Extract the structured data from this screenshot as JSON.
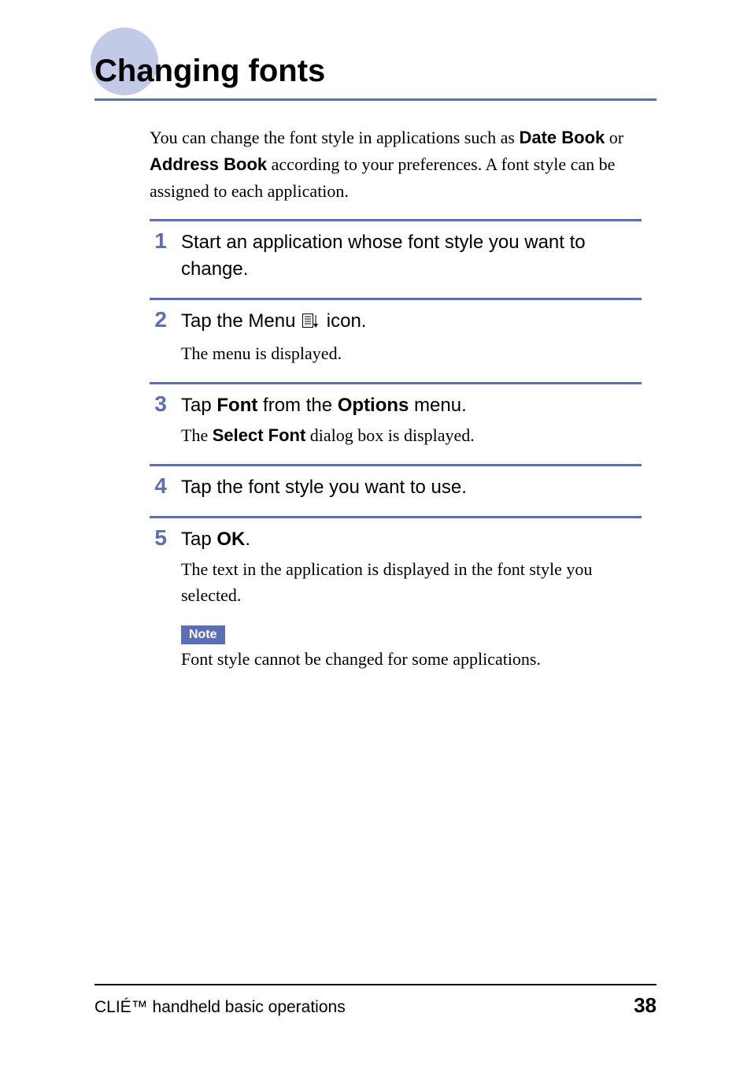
{
  "title": "Changing fonts",
  "intro_html": "You can change the font style in applications such as <b class='sans'>Date Book</b> or <b class='sans'>Address Book</b> according to your preferences. A font style can be assigned to each application.",
  "steps": [
    {
      "num": "1",
      "head_html": "Start an application whose font style you want to change.",
      "sub_html": ""
    },
    {
      "num": "2",
      "head_html": "Tap the Menu <span class='menu-icon' data-name='menu-icon' data-interactable='false'><svg width='22' height='20' viewBox='0 0 22 20'><rect x='0.5' y='0.5' width='13' height='17' fill='none' stroke='#000'/><line x1='3' y1='4' x2='11' y2='4' stroke='#000'/><line x1='3' y1='7' x2='11' y2='7' stroke='#000'/><line x1='3' y1='10' x2='11' y2='10' stroke='#000'/><line x1='3' y1='13' x2='11' y2='13' stroke='#000'/><line x1='17' y1='2' x2='17' y2='14' stroke='#000'/><polygon points='14,13 20,13 17,18' fill='#000'/></svg></span> icon.",
      "sub_html": "The menu is displayed."
    },
    {
      "num": "3",
      "head_html": "Tap <b class='sans'>Font</b> from the <b class='sans'>Options</b> menu.",
      "sub_html": "The <b class='sans'>Select Font</b> dialog box is displayed."
    },
    {
      "num": "4",
      "head_html": "Tap the font style you want to use.",
      "sub_html": ""
    },
    {
      "num": "5",
      "head_html": "Tap <b class='sans'>OK</b>.",
      "sub_html": "The text in the application is displayed in the font style you selected.",
      "note_label": "Note",
      "note_text": "Font style cannot be changed for some applications."
    }
  ],
  "footer": {
    "title": "CLIÉ™ handheld basic operations",
    "page": "38"
  }
}
